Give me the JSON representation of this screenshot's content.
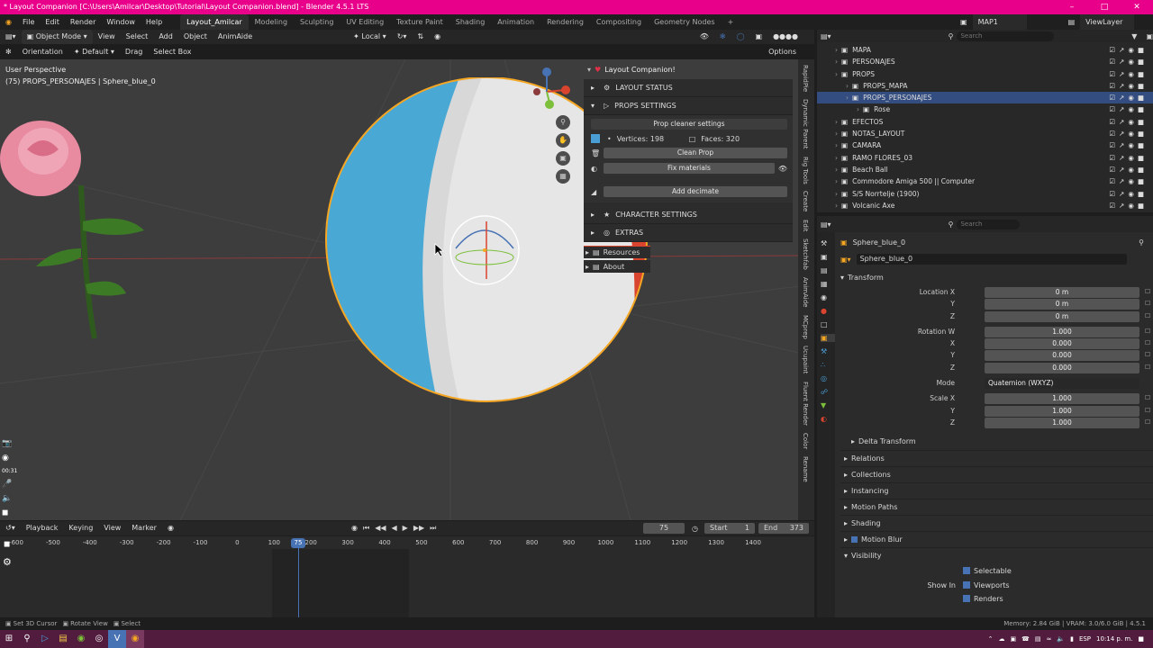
{
  "title": "* Layout Companion [C:\\Users\\Amilcar\\Desktop\\Tutorial\\Layout Companion.blend] - Blender 4.5.1 LTS",
  "menu": [
    "File",
    "Edit",
    "Render",
    "Window",
    "Help"
  ],
  "workspaces": [
    "Layout_Amilcar",
    "Modeling",
    "Sculpting",
    "UV Editing",
    "Texture Paint",
    "Shading",
    "Animation",
    "Rendering",
    "Compositing",
    "Geometry Nodes"
  ],
  "active_workspace": "Layout_Amilcar",
  "scene": "MAP1",
  "view_layer": "ViewLayer",
  "viewport_header": {
    "mode": "Object Mode",
    "items": [
      "View",
      "Select",
      "Add",
      "Object",
      "AnimAide"
    ],
    "transform": "Local"
  },
  "viewport_header2": {
    "orientation_label": "Orientation",
    "orientation": "Default",
    "drag_label": "Drag",
    "drag": "Select Box",
    "options": "Options"
  },
  "overlay": {
    "view_name": "User Perspective",
    "object_info": "(75) PROPS_PERSONAJES | Sphere_blue_0"
  },
  "side_tabs": [
    "RapidPie",
    "Dynamic Parent",
    "Rig Tools",
    "Create",
    "Edit",
    "Sketchfab",
    "AnimAide",
    "MCprep",
    "Ucupaint",
    "Fluent Render",
    "Color",
    "Rename"
  ],
  "panel": {
    "title": "Layout Companion!",
    "layout_status": "LAYOUT STATUS",
    "props_settings": "PROPS SETTINGS",
    "prop_cleaner": "Prop cleaner settings",
    "vertices": "Vertices: 198",
    "faces": "Faces: 320",
    "clean_prop": "Clean Prop",
    "fix_materials": "Fix materials",
    "add_decimate": "Add decimate",
    "character_settings": "CHARACTER SETTINGS",
    "extras": "EXTRAS",
    "resources": "Resources",
    "about": "About"
  },
  "outliner": {
    "search_placeholder": "Search",
    "rows": [
      {
        "label": "MAPA",
        "indent": 0
      },
      {
        "label": "PERSONAJES",
        "indent": 0
      },
      {
        "label": "PROPS",
        "indent": 0
      },
      {
        "label": "PROPS_MAPA",
        "indent": 1
      },
      {
        "label": "PROPS_PERSONAJES",
        "indent": 1
      },
      {
        "label": "Rose",
        "indent": 2
      },
      {
        "label": "EFECTOS",
        "indent": 0
      },
      {
        "label": "NOTAS_LAYOUT",
        "indent": 0
      },
      {
        "label": "CAMARA",
        "indent": 0
      },
      {
        "label": "RAMO FLORES_03",
        "indent": 0
      },
      {
        "label": "Beach Ball",
        "indent": 0
      },
      {
        "label": "Commodore Amiga 500 || Computer",
        "indent": 0
      },
      {
        "label": "S/S Norrtelje (1900)",
        "indent": 0
      },
      {
        "label": "Volcanic Axe",
        "indent": 0
      }
    ]
  },
  "properties": {
    "search_placeholder": "Search",
    "object_name": "Sphere_blue_0",
    "object_field": "Sphere_blue_0",
    "transform": "Transform",
    "location_label": "Location X",
    "location": [
      "0 m",
      "0 m",
      "0 m"
    ],
    "rotation_label": "Rotation W",
    "rotation": [
      "1.000",
      "0.000",
      "0.000",
      "0.000"
    ],
    "mode_label": "Mode",
    "mode": "Quaternion (WXYZ)",
    "scale_label": "Scale X",
    "scale": [
      "1.000",
      "1.000",
      "1.000"
    ],
    "axis_labels": [
      "X",
      "Y",
      "Z"
    ],
    "delta_transform": "Delta Transform",
    "sections": [
      "Relations",
      "Collections",
      "Instancing",
      "Motion Paths",
      "Shading",
      "Motion Blur",
      "Visibility"
    ],
    "selectable": "Selectable",
    "show_in": "Show In",
    "viewports": "Viewports",
    "renders": "Renders"
  },
  "timeline": {
    "items": [
      "Playback",
      "Keying",
      "View",
      "Marker"
    ],
    "current_frame": "75",
    "start_label": "Start",
    "start": "1",
    "end_label": "End",
    "end": "373",
    "ticks": [
      "-600",
      "-500",
      "-400",
      "-300",
      "-200",
      "-100",
      "0",
      "100",
      "200",
      "300",
      "400",
      "500",
      "600",
      "700",
      "800",
      "900",
      "1000",
      "1100",
      "1200",
      "1300",
      "1400"
    ],
    "playhead": "75"
  },
  "status": {
    "left": [
      "Set 3D Cursor",
      "Rotate View",
      "Select"
    ],
    "memory": "Memory: 2.84 GiB | VRAM: 3.0/6.0 GiB | 4.5.1"
  },
  "taskbar": {
    "lang": "ESP",
    "time": "10:14 p. m.",
    "side_time": "00:31"
  },
  "colors": {
    "accent": "#4772b3",
    "titlebar": "#e8008a",
    "selected_orange": "#f5a623"
  }
}
